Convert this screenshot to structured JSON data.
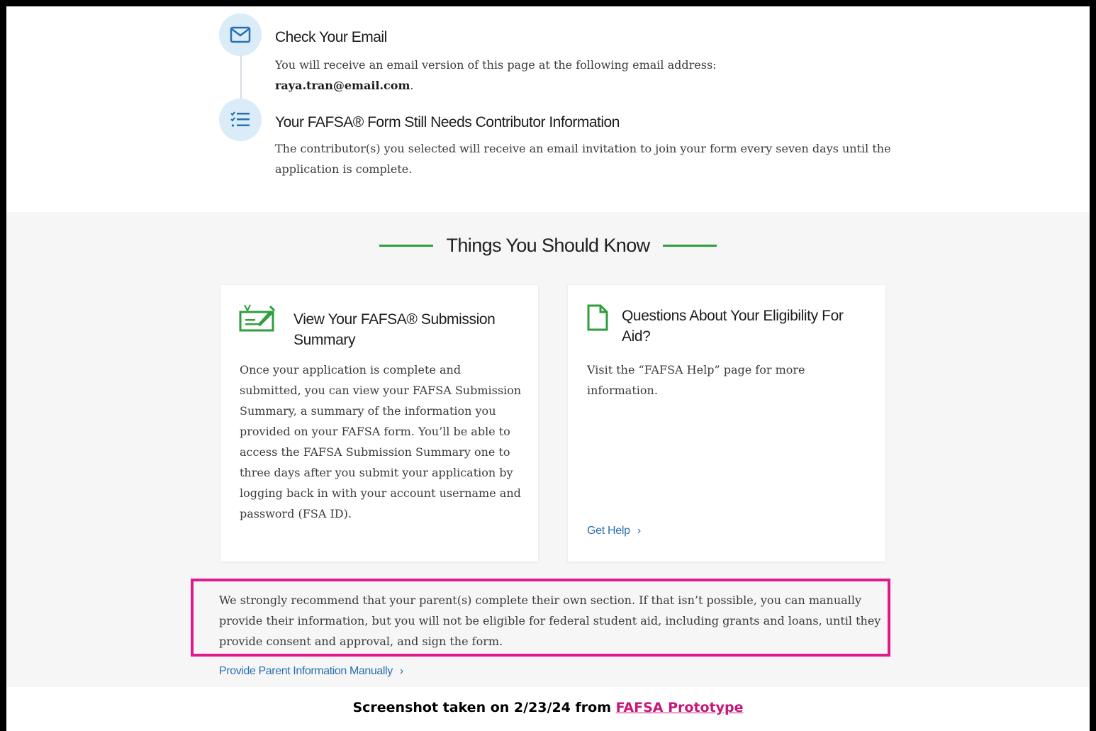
{
  "steps": [
    {
      "icon": "envelope-icon",
      "title": "Check Your Email",
      "text": "You will receive an email version of this page at the following email address:",
      "email": "raya.tran@email.com"
    },
    {
      "icon": "checklist-icon",
      "title": "Your FAFSA® Form Still Needs Contributor Information",
      "text": "The contributor(s) you selected will receive an email invitation to join your form every seven days until the application is complete."
    }
  ],
  "section_title": "Things You Should Know",
  "cards": [
    {
      "icon": "document-signature-icon",
      "title": "View Your FAFSA® Submission Summary",
      "body": "Once your application is complete and submitted, you can view your FAFSA Submission Summary, a summary of the information you provided on your FAFSA form. You’ll be able to access the FAFSA Submission Summary one to three days after you submit your application by logging back in with your account username and password (FSA ID)."
    },
    {
      "icon": "document-icon",
      "title": "Questions About Your Eligibility For Aid?",
      "body": "Visit the “FAFSA Help” page for more information.",
      "link": "Get Help"
    }
  ],
  "notice": "We strongly recommend that your parent(s) complete their own section. If that isn’t possible, you can manually provide their information, but you will not be eligible for federal student aid, including grants and loans, until they provide consent and approval, and sign the form.",
  "manual_link": "Provide Parent Information Manually",
  "caption": {
    "text": "Screenshot taken on 2/23/24 from ",
    "link": "FAFSA Prototype"
  },
  "colors": {
    "accent_green": "#2f9e3e",
    "link_blue": "#2a6fb0",
    "highlight_pink": "#e0198c",
    "icon_circle": "#d9ecf8"
  }
}
